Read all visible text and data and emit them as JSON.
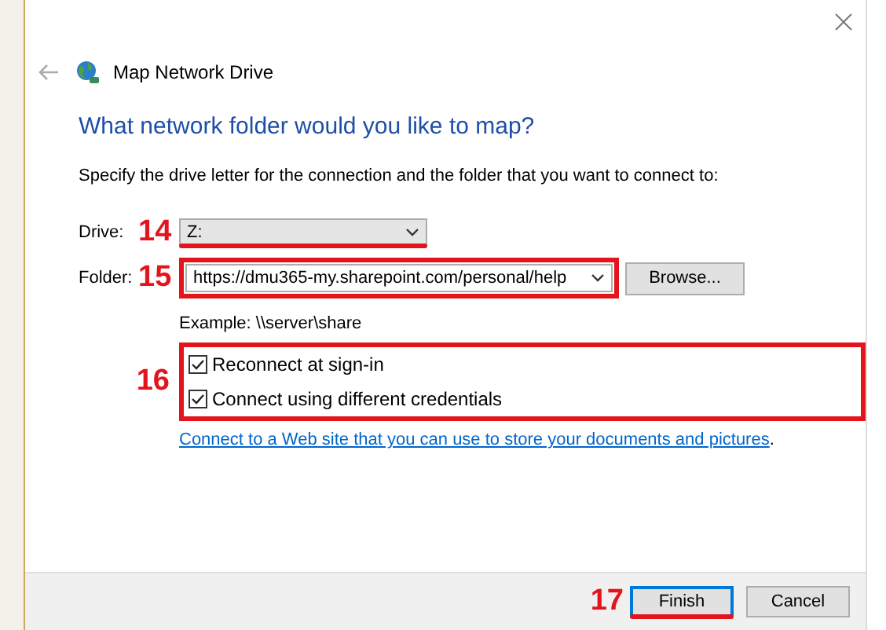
{
  "window": {
    "title": "Map Network Drive"
  },
  "heading": "What network folder would you like to map?",
  "instruction": "Specify the drive letter for the connection and the folder that you want to connect to:",
  "drive": {
    "label": "Drive:",
    "value": "Z:",
    "annotation": {
      "number": "14",
      "kind": "underline"
    }
  },
  "folder": {
    "label": "Folder:",
    "value": "https://dmu365-my.sharepoint.com/personal/help",
    "browse": "Browse...",
    "annotation": {
      "number": "15",
      "kind": "box"
    }
  },
  "example": "Example: \\\\server\\share",
  "options_annotation": {
    "number": "16",
    "kind": "box"
  },
  "options": [
    {
      "label": "Reconnect at sign-in",
      "checked": true
    },
    {
      "label": "Connect using different credentials",
      "checked": true
    }
  ],
  "link": {
    "text": "Connect to a Web site that you can use to store your documents and pictures",
    "suffix": "."
  },
  "buttons": [
    {
      "label": "Finish",
      "default": true,
      "annotation": {
        "number": "17",
        "kind": "underline"
      }
    },
    {
      "label": "Cancel",
      "default": false
    }
  ]
}
